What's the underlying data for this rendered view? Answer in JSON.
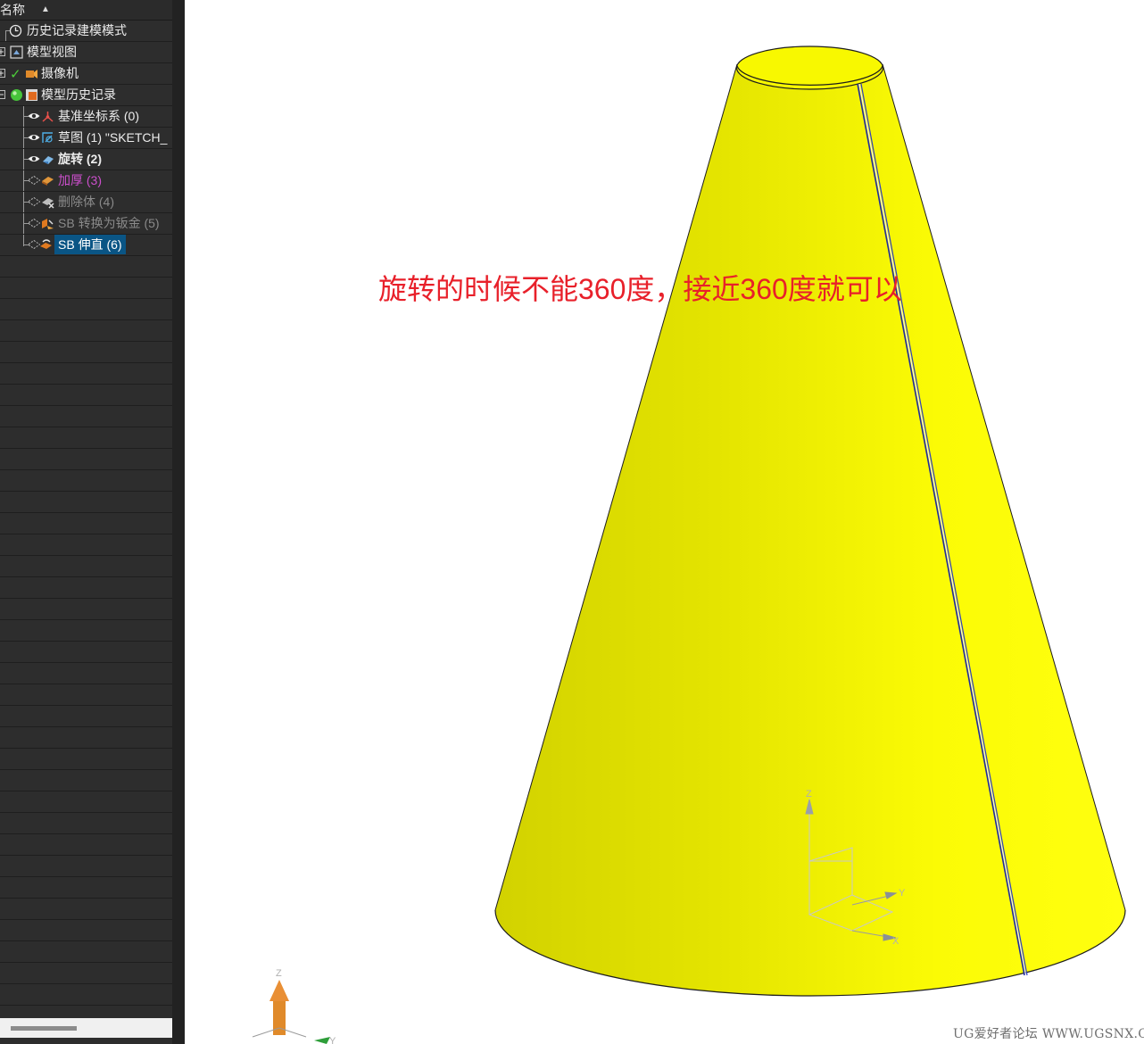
{
  "nav": {
    "header": {
      "label": "名称"
    },
    "nodes": [
      {
        "label": "历史记录建模模式"
      },
      {
        "label": "模型视图"
      },
      {
        "label": "摄像机"
      },
      {
        "label": "模型历史记录"
      },
      {
        "label": "基准坐标系 (0)"
      },
      {
        "label": "草图 (1) \"SKETCH_"
      },
      {
        "label": "旋转 (2)"
      },
      {
        "label": "加厚 (3)"
      },
      {
        "label": "删除体 (4)"
      },
      {
        "label": "SB 转换为钣金 (5)"
      },
      {
        "label": "SB 伸直 (6)"
      }
    ]
  },
  "viewport": {
    "annotation": "旋转的时候不能360度，接近360度就可以",
    "watermark": "UG爱好者论坛 WWW.UGSNX.COM",
    "triad_large": {
      "z": "Z",
      "y": "Y"
    },
    "triad_small": {
      "z": "Z",
      "y": "Y",
      "x": "X"
    }
  },
  "colors": {
    "cone": "#ffff0a",
    "annotation": "#e8202a",
    "selection": "#0a5585",
    "navigator_bg": "#2d2d2d"
  }
}
